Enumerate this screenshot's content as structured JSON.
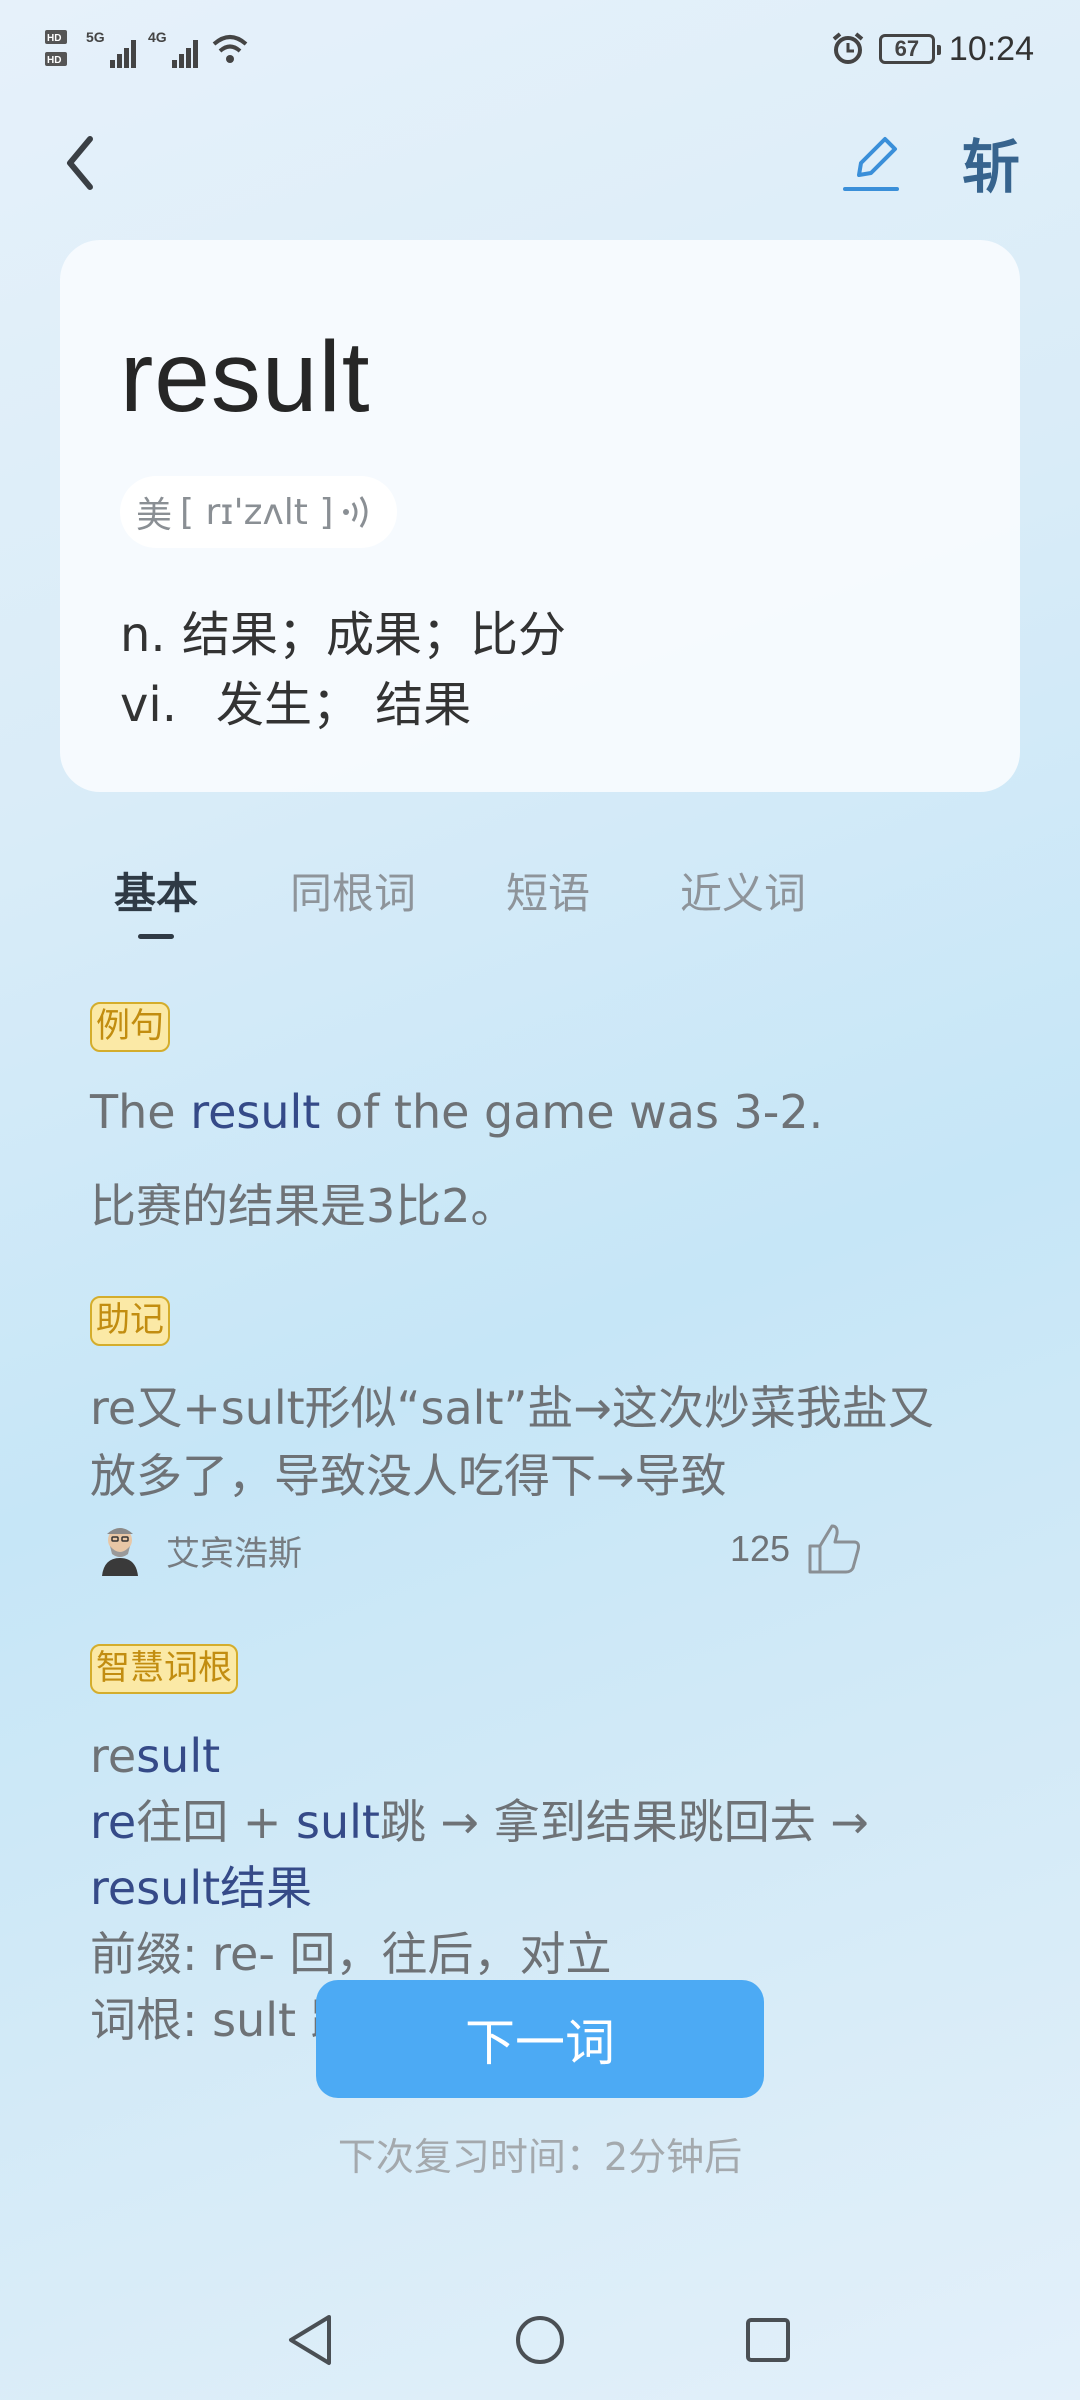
{
  "status_bar": {
    "left_icons": [
      "hd-icon",
      "5g-signal-icon",
      "4g-signal-icon",
      "wifi-icon"
    ],
    "alarm_icon": "alarm-icon",
    "battery": "67",
    "time": "10:24"
  },
  "header": {
    "back_icon": "chevron-left-icon",
    "edit_icon": "pencil-icon",
    "brand_label": "斩",
    "brand_color": "#37648e"
  },
  "word_card": {
    "word": "result",
    "phonetic_region": "美",
    "phonetic": "[ rɪ'zʌlt ]",
    "speaker_icon": "speaker-icon",
    "definitions": [
      {
        "pos": "n.",
        "meaning": "结果；成果；比分"
      },
      {
        "pos": "vi.",
        "meaning": "发生； 结果"
      }
    ]
  },
  "tabs": [
    {
      "label": "基本",
      "active": true
    },
    {
      "label": "同根词",
      "active": false
    },
    {
      "label": "短语",
      "active": false
    },
    {
      "label": "近义词",
      "active": false
    }
  ],
  "example": {
    "tag": "例句",
    "sentence_before": "The ",
    "sentence_highlight": "result",
    "sentence_after": " of the game was 3-2.",
    "translation": "比赛的结果是3比2。"
  },
  "mnemonic": {
    "tag": "助记",
    "line1": "re又+sult形似“salt”盐→这次炒菜我盐又",
    "line2": "放多了，导致没人吃得下→导致",
    "author": "艾宾浩斯",
    "likes": "125",
    "like_icon": "thumbs-up-icon"
  },
  "root": {
    "tag": "智慧词根",
    "word_plain": "re",
    "word_highlight": "sult",
    "line2_prefix": "re",
    "line2_prefix_meaning": "往回 + ",
    "line2_root": "sult",
    "line2_rest": "跳 → 拿到结果跳回去 →",
    "line3_word": "result",
    "line3_meaning": "结果",
    "line4": "前缀: re- 回，往后，对立",
    "line5": "词根: sult 跳"
  },
  "actions": {
    "next_label": "下一词",
    "next_color": "#4caaf4",
    "review_text": "下次复习时间：2分钟后"
  },
  "navbar": {
    "back_icon": "triangle-back-icon",
    "home_icon": "circle-home-icon",
    "recents_icon": "square-recents-icon"
  }
}
